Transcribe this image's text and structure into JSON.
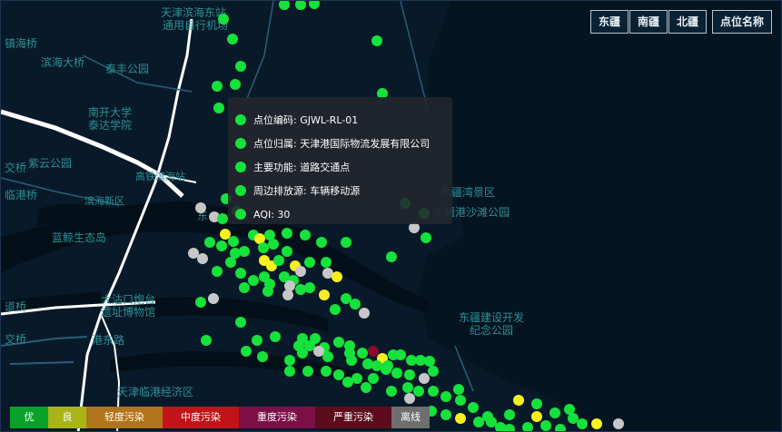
{
  "map": {
    "labels": [
      {
        "id": "binhai-east-station",
        "text": "天津滨海东站"
      },
      {
        "id": "tonglong-park",
        "text": "通用自行机场"
      },
      {
        "id": "zhenqiao",
        "text": "镇海桥"
      },
      {
        "id": "binhai-bridge",
        "text": "滨海大桥"
      },
      {
        "id": "taifeng-park",
        "text": "泰丰公园"
      },
      {
        "id": "nankai-taida",
        "text": "南开大学\n泰达学院"
      },
      {
        "id": "jiaoqiao",
        "text": "交桥"
      },
      {
        "id": "ziyun-park",
        "text": "紫云公园"
      },
      {
        "id": "lingang-bridge",
        "text": "临港桥"
      },
      {
        "id": "binhai-station",
        "text": "高铁滨海站"
      },
      {
        "id": "binhai-newarea",
        "text": "滨海新区"
      },
      {
        "id": "lanhai-ecoisland",
        "text": "蓝鲸生态岛"
      },
      {
        "id": "dong",
        "text": "东"
      },
      {
        "id": "dongjiang-bay",
        "text": "东疆湾景区"
      },
      {
        "id": "dongjiang-beach",
        "text": "东疆港沙滩公园"
      },
      {
        "id": "dagu-fort",
        "text": "大沽口炮台\n遗址博物馆"
      },
      {
        "id": "daoqiao",
        "text": "道桥"
      },
      {
        "id": "jiaoqiao2",
        "text": "交桥"
      },
      {
        "id": "gangdong",
        "text": "港东路"
      },
      {
        "id": "dongjiang-park",
        "text": "东疆建设开发\n纪念公园"
      },
      {
        "id": "lingang-econ",
        "text": "天津临港经济区"
      }
    ]
  },
  "region_buttons": [
    "东疆",
    "南疆",
    "北疆",
    "点位名称"
  ],
  "tooltip": {
    "rows": [
      {
        "label": "点位编码: GJWL-RL-01"
      },
      {
        "label": "点位归属: 天津港国际物流发展有限公司"
      },
      {
        "label": "主要功能: 道路交通点"
      },
      {
        "label": "周边排放源: 车辆移动源"
      },
      {
        "label": "AQI: 30"
      }
    ]
  },
  "legend": [
    {
      "label": "优",
      "color": "#09a12a"
    },
    {
      "label": "良",
      "color": "#a8b418"
    },
    {
      "label": "轻度污染",
      "color": "#b0741a"
    },
    {
      "label": "中度污染",
      "color": "#c0141a"
    },
    {
      "label": "重度污染",
      "color": "#7c0f47"
    },
    {
      "label": "严重污染",
      "color": "#5d0b1d"
    },
    {
      "label": "离线",
      "color": "#6e6e6e"
    }
  ],
  "colors": {
    "good": "#16e23c",
    "moderate": "#f6f01e",
    "heavy": "#8a0b2a",
    "offline": "#c7c7c7"
  }
}
